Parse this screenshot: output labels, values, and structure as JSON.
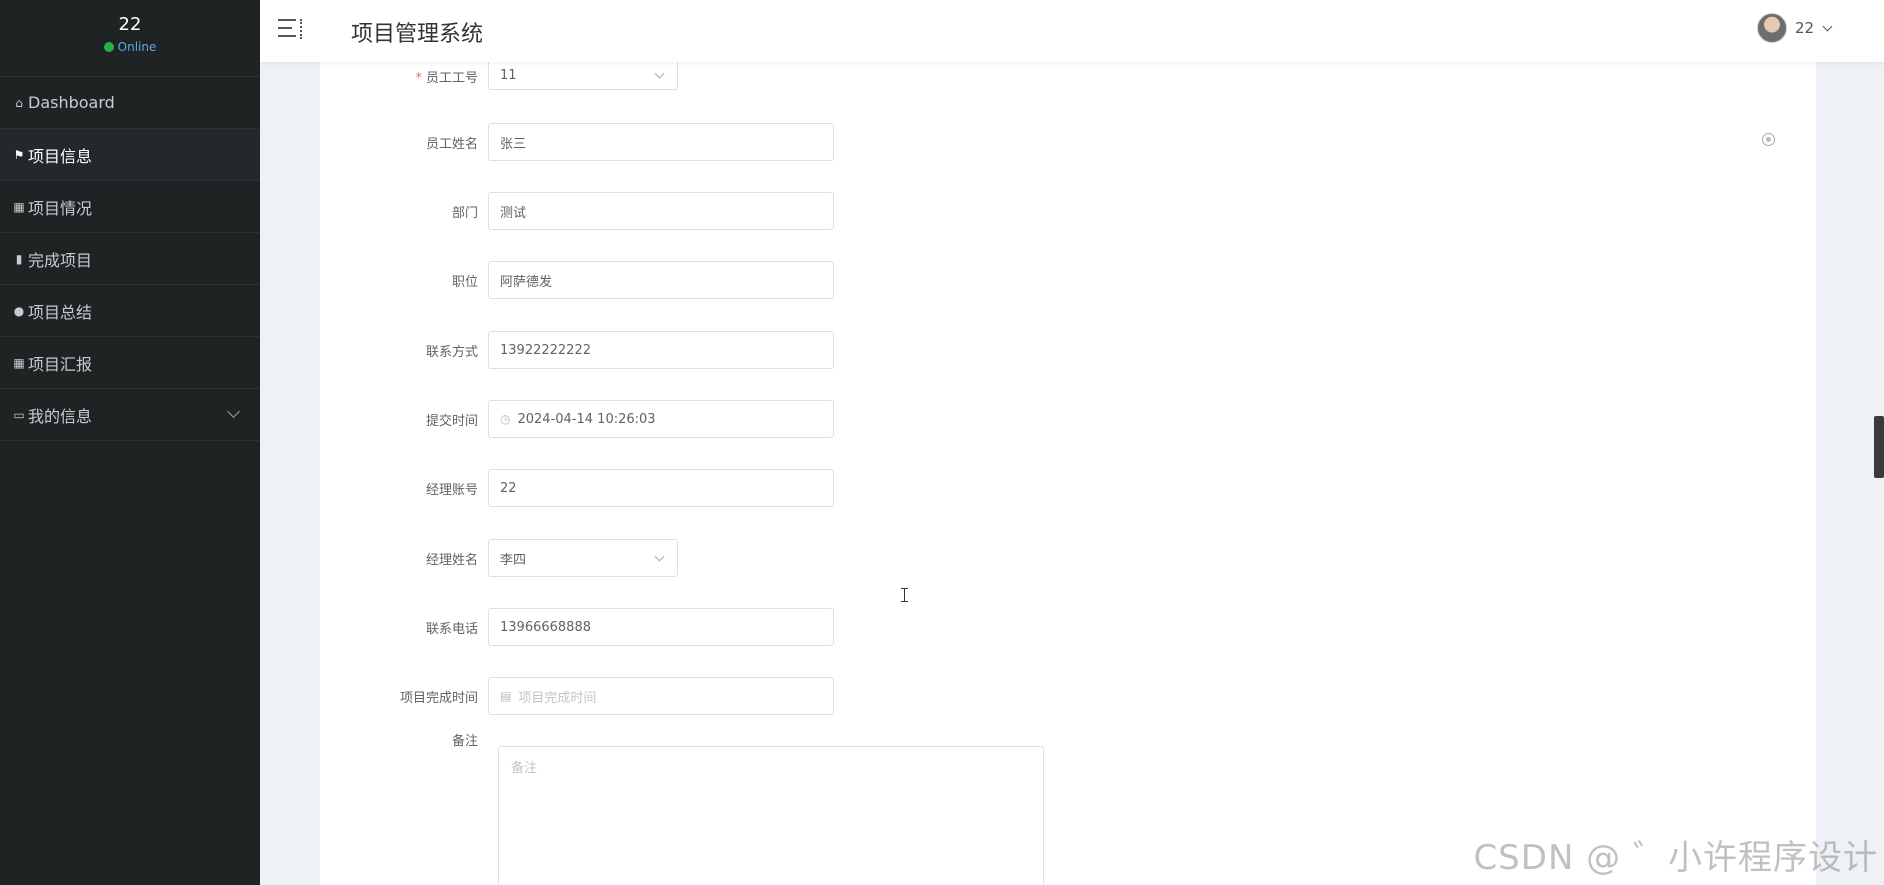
{
  "sidebar": {
    "user_name": "22",
    "status": "Online",
    "items": [
      {
        "label": "Dashboard",
        "icon": "home-icon"
      },
      {
        "label": "项目信息",
        "icon": "flag-icon"
      },
      {
        "label": "项目情况",
        "icon": "grid-icon"
      },
      {
        "label": "完成项目",
        "icon": "bar-chart-icon"
      },
      {
        "label": "项目总结",
        "icon": "user-icon"
      },
      {
        "label": "项目汇报",
        "icon": "grid-icon"
      },
      {
        "label": "我的信息",
        "icon": "card-icon"
      }
    ]
  },
  "header": {
    "title": "项目管理系统",
    "user_name": "22"
  },
  "form": {
    "employee_id": {
      "label": "员工工号",
      "value": "11"
    },
    "employee_name": {
      "label": "员工姓名",
      "value": "张三"
    },
    "department": {
      "label": "部门",
      "value": "测试"
    },
    "position": {
      "label": "职位",
      "value": "阿萨德发"
    },
    "contact": {
      "label": "联系方式",
      "value": "13922222222"
    },
    "submit_time": {
      "label": "提交时间",
      "value": "2024-04-14 10:26:03"
    },
    "manager_account": {
      "label": "经理账号",
      "value": "22"
    },
    "manager_name": {
      "label": "经理姓名",
      "value": "李四"
    },
    "phone": {
      "label": "联系电话",
      "value": "13966668888"
    },
    "complete_time": {
      "label": "项目完成时间",
      "placeholder": "项目完成时间"
    },
    "remark": {
      "label": "备注",
      "placeholder": "备注"
    }
  },
  "watermark": "CSDN @ ゛小许程序设计"
}
